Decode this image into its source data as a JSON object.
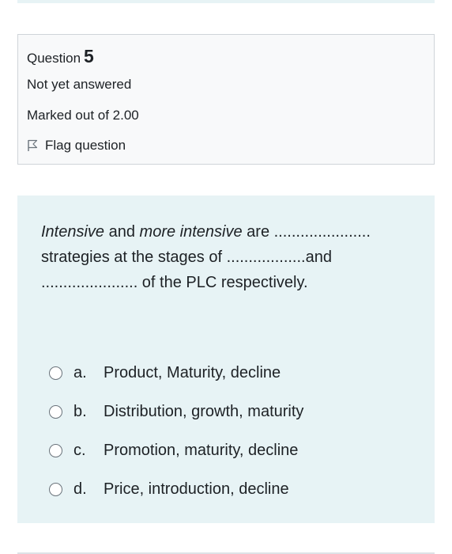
{
  "question_info": {
    "label": "Question",
    "number": "5",
    "state": "Not yet answered",
    "grade": "Marked out of 2.00",
    "flag_label": "Flag question"
  },
  "question_text": {
    "part1_italic": "Intensive",
    "part2": " and ",
    "part3_italic": "more intensive",
    "part4": " are ...................... strategies at the stages of ..................and ...................... of the PLC respectively."
  },
  "answers": [
    {
      "letter": "a.",
      "text": "Product, Maturity, decline"
    },
    {
      "letter": "b.",
      "text": "Distribution, growth, maturity"
    },
    {
      "letter": "c.",
      "text": "Promotion, maturity, decline"
    },
    {
      "letter": "d.",
      "text": "Price, introduction, decline"
    }
  ],
  "colors": {
    "content_background": "#e7f3f5",
    "info_background": "#f8f9fa",
    "text": "#1d2125"
  }
}
